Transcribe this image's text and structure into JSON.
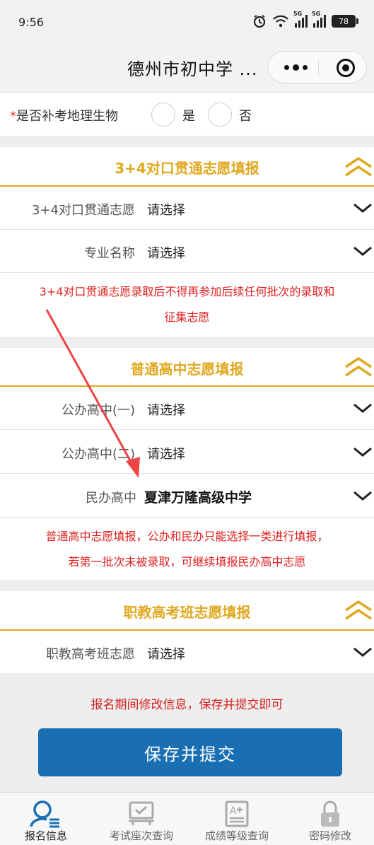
{
  "status_bar": {
    "time": "9:56",
    "battery": "78",
    "network": [
      "5G",
      "5G"
    ]
  },
  "nav": {
    "title": "德州市初中学 ..."
  },
  "makeup_question": {
    "label": "是否补考地理生物",
    "options": [
      "是",
      "否"
    ]
  },
  "section_34": {
    "title": "3+4对口贯通志愿填报",
    "rows": [
      {
        "label": "3+4对口贯通志愿",
        "value": "请选择"
      },
      {
        "label": "专业名称",
        "value": "请选择"
      }
    ],
    "note_lines": [
      "3+4对口贯通志愿录取后不得再参加后续任何批次的录取和",
      "征集志愿"
    ]
  },
  "section_general": {
    "title": "普通高中志愿填报",
    "rows": [
      {
        "label": "公办高中(一)",
        "value": "请选择"
      },
      {
        "label": "公办高中(二)",
        "value": "请选择"
      },
      {
        "label": "民办高中",
        "value": "夏津万隆高级中学"
      }
    ],
    "note_lines": [
      "普通高中志愿填报，公办和民办只能选择一类进行填报，",
      "若第一批次未被录取，可继续填报民办高中志愿"
    ]
  },
  "section_vocational": {
    "title": "职教高考班志愿填报",
    "rows": [
      {
        "label": "职教高考班志愿",
        "value": "请选择"
      }
    ]
  },
  "save_note": "报名期间修改信息，保存并提交即可",
  "save_button": "保存并提交",
  "tabs": [
    {
      "label": "报名信息",
      "icon": "user-info-icon",
      "active": true
    },
    {
      "label": "考试座次查询",
      "icon": "seat-query-icon",
      "active": false
    },
    {
      "label": "成绩等级查询",
      "icon": "grade-query-icon",
      "active": false
    },
    {
      "label": "密码修改",
      "icon": "lock-icon",
      "active": false
    }
  ],
  "colors": {
    "accent_gold": "#e0a820",
    "note_red": "#e02020",
    "button_blue": "#1a6fb3",
    "arrow_red": "#ee4444"
  }
}
